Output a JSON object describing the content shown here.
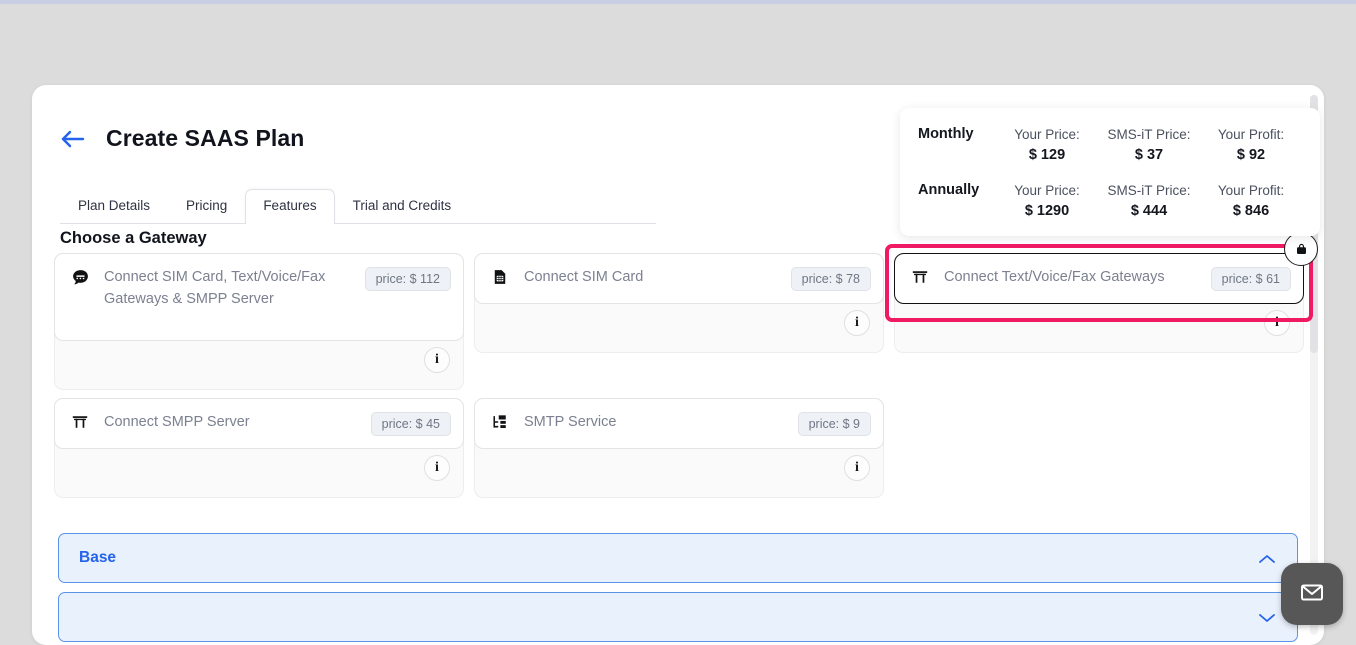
{
  "header": {
    "title": "Create SAAS Plan",
    "back_icon": "arrow-left-icon"
  },
  "tabs": [
    {
      "label": "Plan Details",
      "active": false
    },
    {
      "label": "Pricing",
      "active": false
    },
    {
      "label": "Features",
      "active": true
    },
    {
      "label": "Trial and Credits",
      "active": false
    }
  ],
  "section": {
    "title": "Choose a Gateway"
  },
  "gateways": [
    {
      "label": "Connect SIM Card, Text/Voice/Fax Gateways & SMPP Server",
      "price": "price: $ 112",
      "icon": "sms-bubble-icon",
      "info": "i",
      "selected": false,
      "tall": true
    },
    {
      "label": "Connect SIM Card",
      "price": "price: $ 78",
      "icon": "sim-card-icon",
      "info": "i",
      "selected": false,
      "tall": false
    },
    {
      "label": "Connect Text/Voice/Fax Gateways",
      "price": "price: $ 61",
      "icon": "gateway-icon",
      "info": "i",
      "selected": true,
      "tall": false
    },
    {
      "label": "Connect SMPP Server",
      "price": "price: $ 45",
      "icon": "gateway-icon",
      "info": "i",
      "selected": false,
      "tall": false
    },
    {
      "label": "SMTP Service",
      "price": "price: $ 9",
      "icon": "smtp-icon",
      "info": "i",
      "selected": false,
      "tall": false
    }
  ],
  "price_popup": {
    "rows": [
      {
        "period": "Monthly",
        "cols": [
          {
            "caption": "Your Price:",
            "value": "$ 129"
          },
          {
            "caption": "SMS-iT Price:",
            "value": "$ 37"
          },
          {
            "caption": "Your Profit:",
            "value": "$ 92"
          }
        ]
      },
      {
        "period": "Annually",
        "cols": [
          {
            "caption": "Your Price:",
            "value": "$ 1290"
          },
          {
            "caption": "SMS-iT Price:",
            "value": "$ 444"
          },
          {
            "caption": "Your Profit:",
            "value": "$ 846"
          }
        ]
      }
    ]
  },
  "accordions": [
    {
      "title": "Base",
      "expanded": true,
      "chevron": "chevron-up-icon"
    },
    {
      "title": "",
      "expanded": false,
      "chevron": "chevron-down-icon"
    }
  ],
  "fab": {
    "icon": "envelope-icon"
  },
  "colors": {
    "accent_blue": "#2563eb",
    "highlight_pink": "#ef1a63",
    "page_bg": "#dcdcdc",
    "panel_bg": "#ffffff",
    "accordion_bg": "#e9f1fd"
  }
}
